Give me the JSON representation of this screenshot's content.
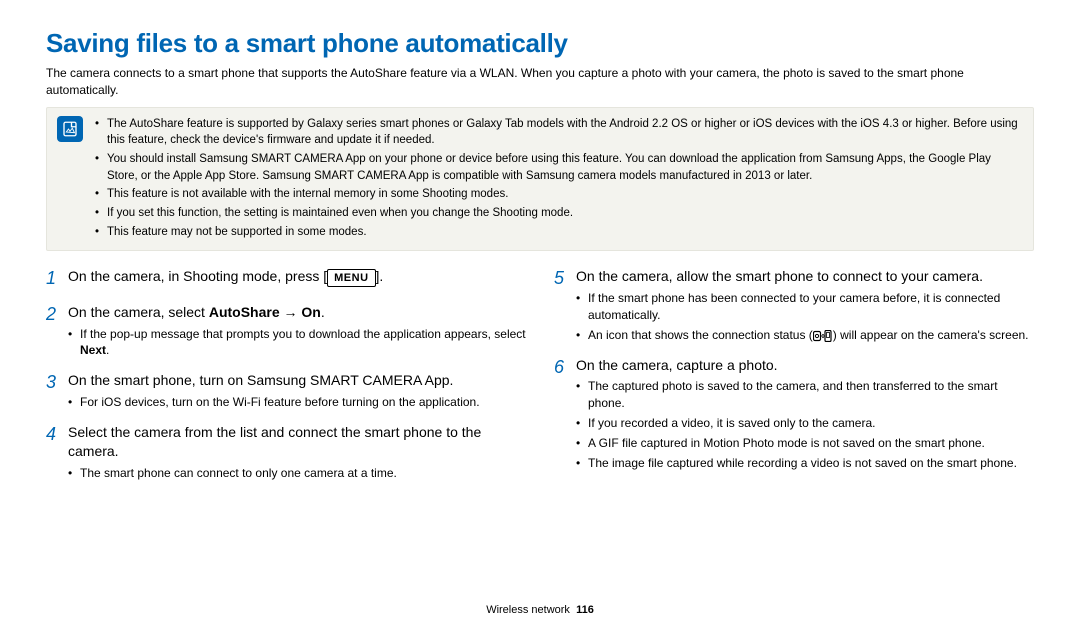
{
  "title": "Saving files to a smart phone automatically",
  "intro": "The camera connects to a smart phone that supports the AutoShare feature via a WLAN. When you capture a photo with your camera, the photo is saved to the smart phone automatically.",
  "notes": [
    "The AutoShare feature is supported by Galaxy series smart phones or Galaxy Tab models with the Android 2.2 OS or higher or iOS devices with the iOS 4.3 or higher. Before using this feature, check the device's firmware and update it if needed.",
    "You should install Samsung SMART CAMERA App on your phone or device before using this feature. You can download the application from Samsung Apps, the Google Play Store, or the Apple App Store. Samsung SMART CAMERA App is compatible with Samsung camera models manufactured in 2013 or later.",
    "This feature is not available with the internal memory in some Shooting modes.",
    "If you set this function, the setting is maintained even when you change the Shooting mode.",
    "This feature may not be supported in some modes."
  ],
  "steps_left": {
    "s1": {
      "num": "1",
      "pre": "On the camera, in Shooting mode, press [",
      "btn": "MENU",
      "post": "]."
    },
    "s2": {
      "num": "2",
      "pre": "On the camera, select ",
      "bold": "AutoShare",
      "arrow": " → ",
      "bold2": "On",
      "post": ".",
      "sub_pre": "If the pop-up message that prompts you to download the application appears, select ",
      "sub_bold": "Next",
      "sub_post": "."
    },
    "s3": {
      "num": "3",
      "text": "On the smart phone, turn on Samsung SMART CAMERA App.",
      "sub1": "For iOS devices, turn on the Wi-Fi feature before turning on the application."
    },
    "s4": {
      "num": "4",
      "text": "Select the camera from the list and connect the smart phone to the camera.",
      "sub1": "The smart phone can connect to only one camera at a time."
    }
  },
  "steps_right": {
    "s5": {
      "num": "5",
      "text": "On the camera, allow the smart phone to connect to your camera.",
      "sub1": "If the smart phone has been connected to your camera before, it is connected automatically.",
      "sub2_pre": "An icon that shows the connection status (",
      "sub2_post": ") will appear on the camera's screen."
    },
    "s6": {
      "num": "6",
      "text": "On the camera, capture a photo.",
      "sub1": "The captured photo is saved to the camera, and then transferred to the smart phone.",
      "sub2": "If you recorded a video, it is saved only to the camera.",
      "sub3": "A GIF file captured in Motion Photo mode is not saved on the smart phone.",
      "sub4": "The image file captured while recording a video is not saved on the smart phone."
    }
  },
  "footer_section": "Wireless network",
  "footer_page": "116"
}
